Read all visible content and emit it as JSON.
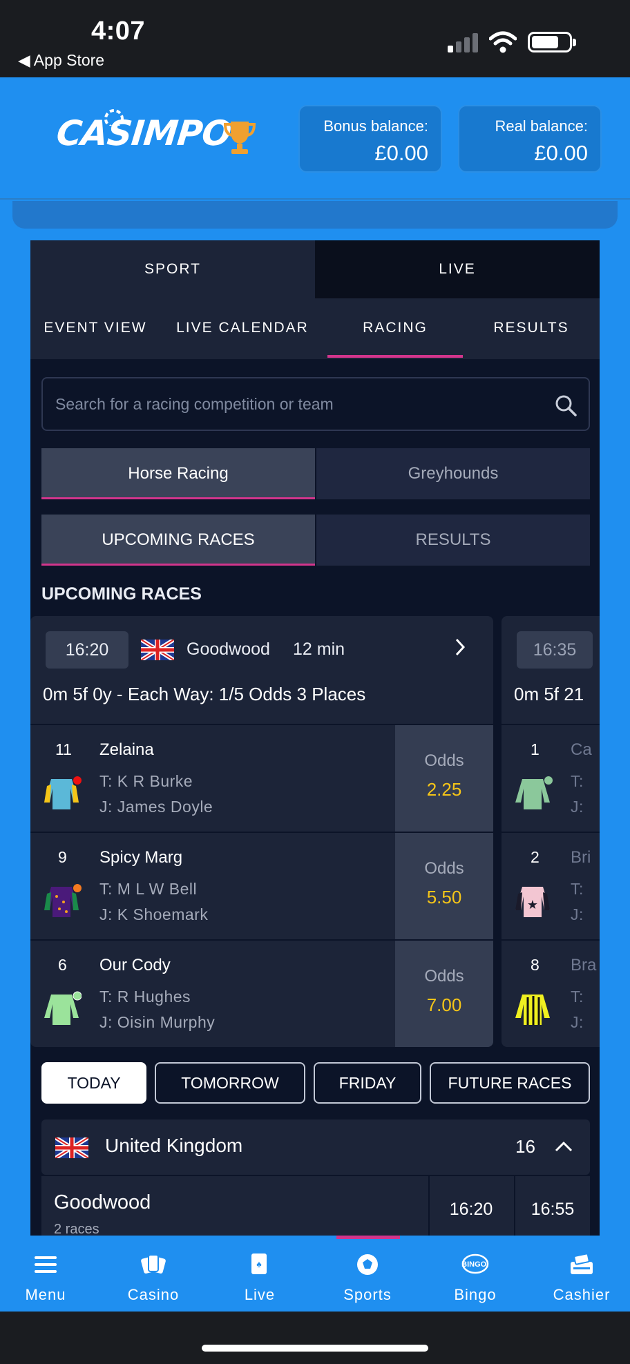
{
  "status_bar": {
    "time": "4:07",
    "back_label": "◀ App Store"
  },
  "header": {
    "logo": "CASIMPO",
    "bonus_label": "Bonus balance:",
    "bonus_value": "£0.00",
    "real_label": "Real balance:",
    "real_value": "£0.00"
  },
  "top_tabs": {
    "sport": "SPORT",
    "live": "LIVE"
  },
  "sub_nav": {
    "event_view": "EVENT VIEW",
    "live_calendar": "LIVE CALENDAR",
    "racing": "RACING",
    "results": "RESULTS"
  },
  "search": {
    "placeholder": "Search for a racing competition or team"
  },
  "racing_type": {
    "horse": "Horse Racing",
    "greyhounds": "Greyhounds"
  },
  "race_view": {
    "upcoming": "UPCOMING RACES",
    "results": "RESULTS"
  },
  "section_title": "UPCOMING RACES",
  "race_cards": [
    {
      "time": "16:20",
      "course": "Goodwood",
      "countdown": "12 min",
      "details": "0m 5f 0y - Each Way: 1/5 Odds 3 Places",
      "runners": [
        {
          "num": "11",
          "name": "Zelaina",
          "trainer": "T: K R Burke",
          "jockey": "J: James Doyle",
          "odds_label": "Odds",
          "odds": "2.25"
        },
        {
          "num": "9",
          "name": "Spicy Marg",
          "trainer": "T: M L W Bell",
          "jockey": "J: K Shoemark",
          "odds_label": "Odds",
          "odds": "5.50"
        },
        {
          "num": "6",
          "name": "Our Cody",
          "trainer": "T: R Hughes",
          "jockey": "J: Oisin Murphy",
          "odds_label": "Odds",
          "odds": "7.00"
        }
      ]
    },
    {
      "time": "16:35",
      "details": "0m 5f 21",
      "runners": [
        {
          "num": "1",
          "name": "Ca",
          "trainer": "T:",
          "jockey": "J:"
        },
        {
          "num": "2",
          "name": "Bri",
          "trainer": "T:",
          "jockey": "J:"
        },
        {
          "num": "8",
          "name": "Bra",
          "trainer": "T:",
          "jockey": "J:"
        }
      ]
    }
  ],
  "days": [
    "TODAY",
    "TOMORROW",
    "FRIDAY",
    "FUTURE RACES"
  ],
  "country": {
    "name": "United Kingdom",
    "count": "16"
  },
  "meeting": {
    "name": "Goodwood",
    "sub": "2 races",
    "times": [
      "16:20",
      "16:55"
    ]
  },
  "bottom_nav": [
    "Menu",
    "Casino",
    "Live",
    "Sports",
    "Bingo",
    "Cashier"
  ],
  "colors": {
    "accent": "#d2358c",
    "brand_blue": "#1f8ff0",
    "odds": "#f5c518",
    "panel": "#0c1428"
  }
}
